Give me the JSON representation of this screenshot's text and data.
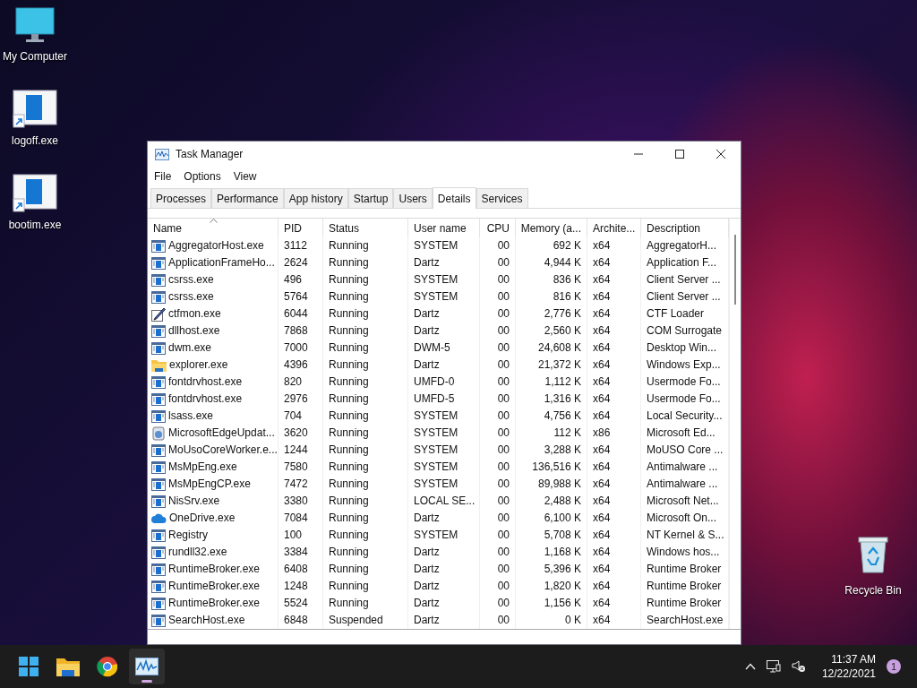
{
  "desktop_icons": [
    {
      "label": "My Computer",
      "kind": "monitor"
    },
    {
      "label": "logoff.exe",
      "kind": "shortcut"
    },
    {
      "label": "bootim.exe",
      "kind": "shortcut"
    },
    {
      "label": "Recycle Bin",
      "kind": "bin"
    }
  ],
  "window": {
    "title": "Task Manager"
  },
  "menu": [
    "File",
    "Options",
    "View"
  ],
  "tabs": [
    {
      "label": "Processes",
      "selected": false
    },
    {
      "label": "Performance",
      "selected": false
    },
    {
      "label": "App history",
      "selected": false
    },
    {
      "label": "Startup",
      "selected": false
    },
    {
      "label": "Users",
      "selected": false
    },
    {
      "label": "Details",
      "selected": true
    },
    {
      "label": "Services",
      "selected": false
    }
  ],
  "table": {
    "columns": [
      "Name",
      "PID",
      "Status",
      "User name",
      "CPU",
      "Memory (a...",
      "Archite...",
      "Description"
    ],
    "rows": [
      {
        "kind": "app",
        "cells": [
          "AggregatorHost.exe",
          "3112",
          "Running",
          "SYSTEM",
          "00",
          "692 K",
          "x64",
          "AggregatorH..."
        ]
      },
      {
        "kind": "app",
        "cells": [
          "ApplicationFrameHo...",
          "2624",
          "Running",
          "Dartz",
          "00",
          "4,944 K",
          "x64",
          "Application F..."
        ]
      },
      {
        "kind": "app",
        "cells": [
          "csrss.exe",
          "496",
          "Running",
          "SYSTEM",
          "00",
          "836 K",
          "x64",
          "Client Server ..."
        ]
      },
      {
        "kind": "app",
        "cells": [
          "csrss.exe",
          "5764",
          "Running",
          "SYSTEM",
          "00",
          "816 K",
          "x64",
          "Client Server ..."
        ]
      },
      {
        "kind": "pen",
        "cells": [
          "ctfmon.exe",
          "6044",
          "Running",
          "Dartz",
          "00",
          "2,776 K",
          "x64",
          "CTF Loader"
        ]
      },
      {
        "kind": "app",
        "cells": [
          "dllhost.exe",
          "7868",
          "Running",
          "Dartz",
          "00",
          "2,560 K",
          "x64",
          "COM Surrogate"
        ]
      },
      {
        "kind": "app",
        "cells": [
          "dwm.exe",
          "7000",
          "Running",
          "DWM-5",
          "00",
          "24,608 K",
          "x64",
          "Desktop Win..."
        ]
      },
      {
        "kind": "folder",
        "cells": [
          "explorer.exe",
          "4396",
          "Running",
          "Dartz",
          "00",
          "21,372 K",
          "x64",
          "Windows Exp..."
        ]
      },
      {
        "kind": "app",
        "cells": [
          "fontdrvhost.exe",
          "820",
          "Running",
          "UMFD-0",
          "00",
          "1,112 K",
          "x64",
          "Usermode Fo..."
        ]
      },
      {
        "kind": "app",
        "cells": [
          "fontdrvhost.exe",
          "2976",
          "Running",
          "UMFD-5",
          "00",
          "1,316 K",
          "x64",
          "Usermode Fo..."
        ]
      },
      {
        "kind": "app",
        "cells": [
          "lsass.exe",
          "704",
          "Running",
          "SYSTEM",
          "00",
          "4,756 K",
          "x64",
          "Local Security..."
        ]
      },
      {
        "kind": "installer",
        "cells": [
          "MicrosoftEdgeUpdat...",
          "3620",
          "Running",
          "SYSTEM",
          "00",
          "112 K",
          "x86",
          "Microsoft Ed..."
        ]
      },
      {
        "kind": "app",
        "cells": [
          "MoUsoCoreWorker.e...",
          "1244",
          "Running",
          "SYSTEM",
          "00",
          "3,288 K",
          "x64",
          "MoUSO Core ..."
        ]
      },
      {
        "kind": "app",
        "cells": [
          "MsMpEng.exe",
          "7580",
          "Running",
          "SYSTEM",
          "00",
          "136,516 K",
          "x64",
          "Antimalware ..."
        ]
      },
      {
        "kind": "app",
        "cells": [
          "MsMpEngCP.exe",
          "7472",
          "Running",
          "SYSTEM",
          "00",
          "89,988 K",
          "x64",
          "Antimalware ..."
        ]
      },
      {
        "kind": "app",
        "cells": [
          "NisSrv.exe",
          "3380",
          "Running",
          "LOCAL SE...",
          "00",
          "2,488 K",
          "x64",
          "Microsoft Net..."
        ]
      },
      {
        "kind": "cloud",
        "cells": [
          "OneDrive.exe",
          "7084",
          "Running",
          "Dartz",
          "00",
          "6,100 K",
          "x64",
          "Microsoft On..."
        ]
      },
      {
        "kind": "app",
        "cells": [
          "Registry",
          "100",
          "Running",
          "SYSTEM",
          "00",
          "5,708 K",
          "x64",
          "NT Kernel & S..."
        ]
      },
      {
        "kind": "app",
        "cells": [
          "rundll32.exe",
          "3384",
          "Running",
          "Dartz",
          "00",
          "1,168 K",
          "x64",
          "Windows hos..."
        ]
      },
      {
        "kind": "app",
        "cells": [
          "RuntimeBroker.exe",
          "6408",
          "Running",
          "Dartz",
          "00",
          "5,396 K",
          "x64",
          "Runtime Broker"
        ]
      },
      {
        "kind": "app",
        "cells": [
          "RuntimeBroker.exe",
          "1248",
          "Running",
          "Dartz",
          "00",
          "1,820 K",
          "x64",
          "Runtime Broker"
        ]
      },
      {
        "kind": "app",
        "cells": [
          "RuntimeBroker.exe",
          "5524",
          "Running",
          "Dartz",
          "00",
          "1,156 K",
          "x64",
          "Runtime Broker"
        ]
      },
      {
        "kind": "app",
        "cells": [
          "SearchHost.exe",
          "6848",
          "Suspended",
          "Dartz",
          "00",
          "0 K",
          "x64",
          "SearchHost.exe"
        ]
      }
    ]
  },
  "taskbar": {
    "apps": [
      {
        "kind": "start",
        "selected": false
      },
      {
        "kind": "folder",
        "selected": false
      },
      {
        "kind": "browser",
        "selected": false
      },
      {
        "kind": "taskmgr",
        "selected": true
      }
    ],
    "time": "11:37 AM",
    "date": "12/22/2021",
    "notification_count": "1"
  }
}
